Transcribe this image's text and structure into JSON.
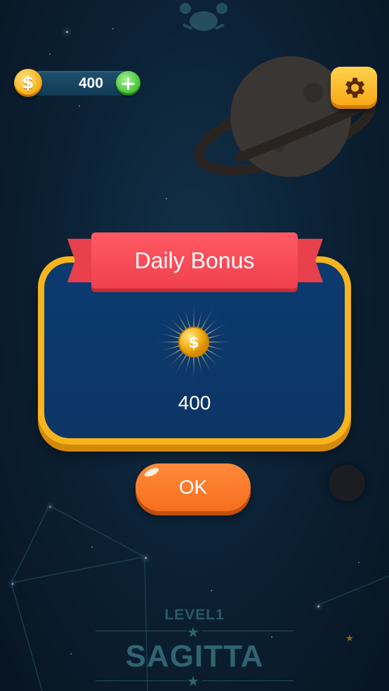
{
  "hud": {
    "coins": "400",
    "coin_symbol": "$",
    "plus_symbol": "+",
    "coin_icon": "dollar-coin-icon",
    "add_icon": "plus-icon",
    "settings_icon": "gear-icon"
  },
  "dialog": {
    "title": "Daily Bonus",
    "reward_amount": "400",
    "reward_symbol": "$",
    "reward_icon": "shining-coin-icon",
    "ok_label": "OK"
  },
  "constellation": {
    "level": "LEVEL1",
    "name": "SAGITTA"
  },
  "colors": {
    "background": "#0c2236",
    "coin": "#f6b21a",
    "add_button": "#4dc83e",
    "settings_button": "#f6a512",
    "dialog_frame": "#f6b41e",
    "dialog_fill": "#0c3b70",
    "ribbon": "#f1414f",
    "ok_button": "#f66f1f"
  }
}
